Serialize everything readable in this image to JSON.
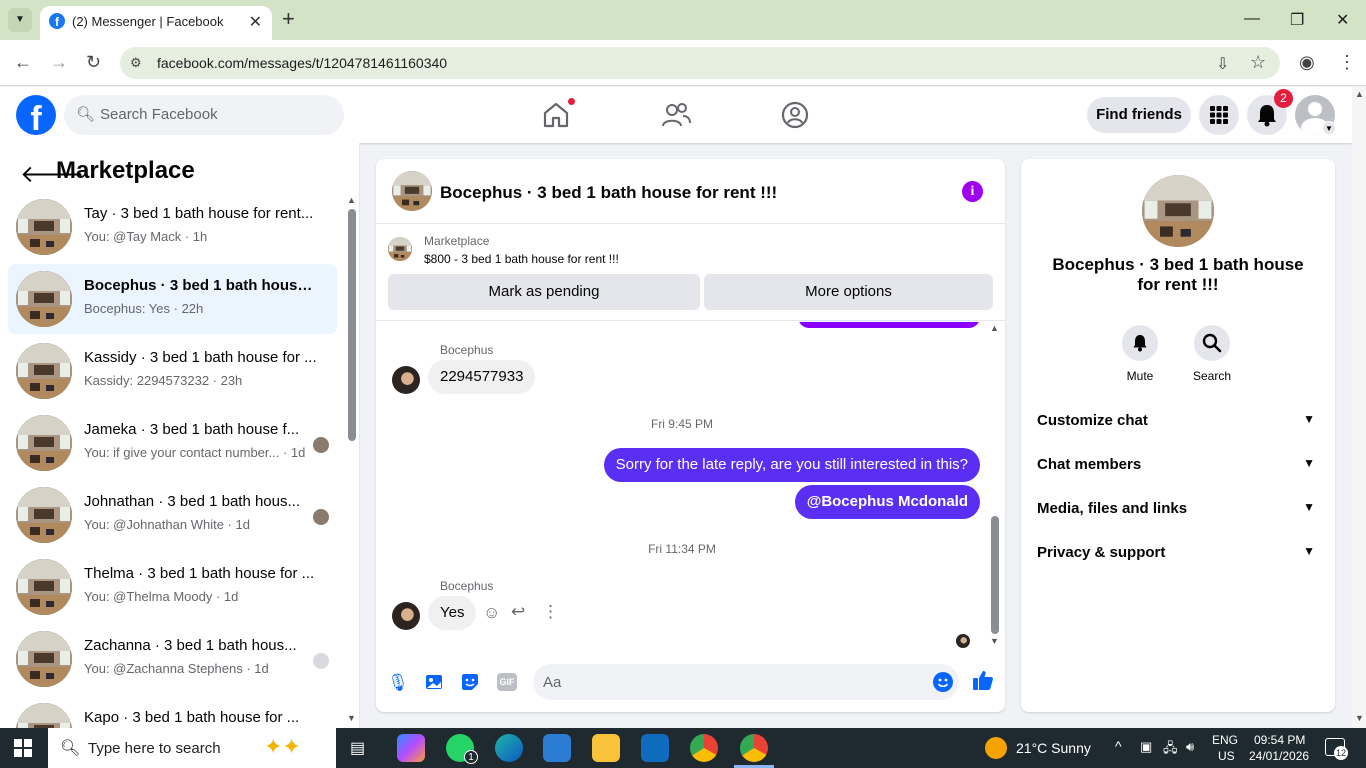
{
  "browser": {
    "tab_title": "(2) Messenger | Facebook",
    "url": "facebook.com/messages/t/1204781461160340"
  },
  "fb_header": {
    "search_placeholder": "Search Facebook",
    "find_friends": "Find friends",
    "notification_count": "2"
  },
  "sidebar": {
    "title": "Marketplace",
    "conversations": [
      {
        "name": "Tay · 3 bed 1 bath house for rent...",
        "sub": "You: @Tay Mack · 1h",
        "seen": "none"
      },
      {
        "name": "Bocephus · 3 bed 1 bath house f...",
        "sub": "Bocephus: Yes · 22h",
        "seen": "none",
        "active": true
      },
      {
        "name": "Kassidy · 3 bed 1 bath house for ...",
        "sub": "Kassidy: 2294573232 · 23h",
        "seen": "none"
      },
      {
        "name": "Jameka · 3 bed 1 bath house f...",
        "sub": "You: if give your contact number... · 1d",
        "seen": "photo"
      },
      {
        "name": "Johnathan · 3 bed 1 bath hous...",
        "sub": "You: @Johnathan White · 1d",
        "seen": "photo"
      },
      {
        "name": "Thelma · 3 bed 1 bath house for ...",
        "sub": "You: @Thelma Moody · 1d",
        "seen": "none"
      },
      {
        "name": "Zachanna · 3 bed 1 bath hous...",
        "sub": "You: @Zachanna Stephens · 1d",
        "seen": "gray"
      },
      {
        "name": "Kapo · 3 bed 1 bath house for ...",
        "sub": "",
        "seen": "photo"
      }
    ]
  },
  "chat": {
    "title": "Bocephus · 3 bed 1 bath house for rent !!!",
    "marketplace_label": "Marketplace",
    "listing": "$800 - 3 bed 1 bath house for rent !!!",
    "mark_pending": "Mark as pending",
    "more_options": "More options",
    "messages": {
      "sender1": "Bocephus",
      "msg1": "2294577933",
      "time1": "Fri 9:45 PM",
      "out1": "Sorry for the late reply, are you still interested in this?",
      "out2": "@Bocephus Mcdonald",
      "time2": "Fri 11:34 PM",
      "sender2": "Bocephus",
      "msg2": "Yes"
    },
    "composer_placeholder": "Aa",
    "gif_label": "GIF"
  },
  "details": {
    "title": "Bocephus · 3 bed 1 bath house for rent !!!",
    "mute": "Mute",
    "search": "Search",
    "rows": [
      "Customize chat",
      "Chat members",
      "Media, files and links",
      "Privacy & support"
    ]
  },
  "taskbar": {
    "search_placeholder": "Type here to search",
    "weather": "21°C  Sunny",
    "lang1": "ENG",
    "lang2": "US",
    "time": "09:54 PM",
    "date": "24/01/2026",
    "whatsapp_badge": "1",
    "notif_count": "12"
  },
  "colors": {
    "fb_blue": "#0866ff",
    "outgoing_bubble": "#5b2ef4",
    "info_purple": "#a000f0",
    "active_convo": "#ebf5ff"
  }
}
